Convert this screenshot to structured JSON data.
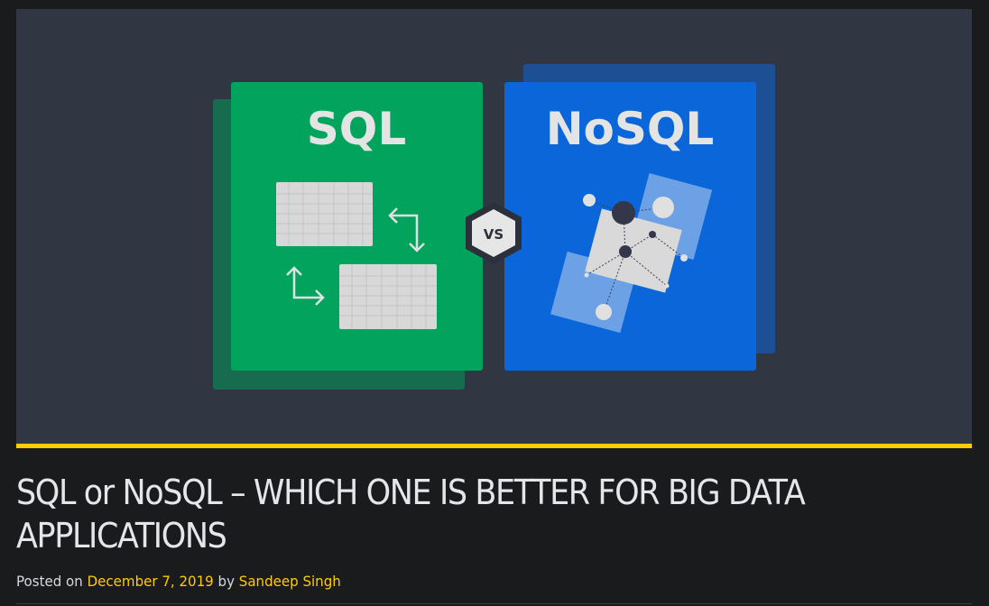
{
  "hero": {
    "left_label": "SQL",
    "right_label": "NoSQL",
    "badge": "VS",
    "colors": {
      "sql": "#02a45d",
      "sql_shadow": "#176b4f",
      "nosql": "#0a66d9",
      "nosql_shadow": "#1c4f93",
      "accent": "#ffcc00"
    }
  },
  "post": {
    "title": "SQL or NoSQL – WHICH ONE IS BETTER FOR BIG DATA APPLICATIONS",
    "posted_on_label": "Posted on",
    "date": "December 7, 2019",
    "by_label": "by",
    "author": "Sandeep Singh"
  }
}
